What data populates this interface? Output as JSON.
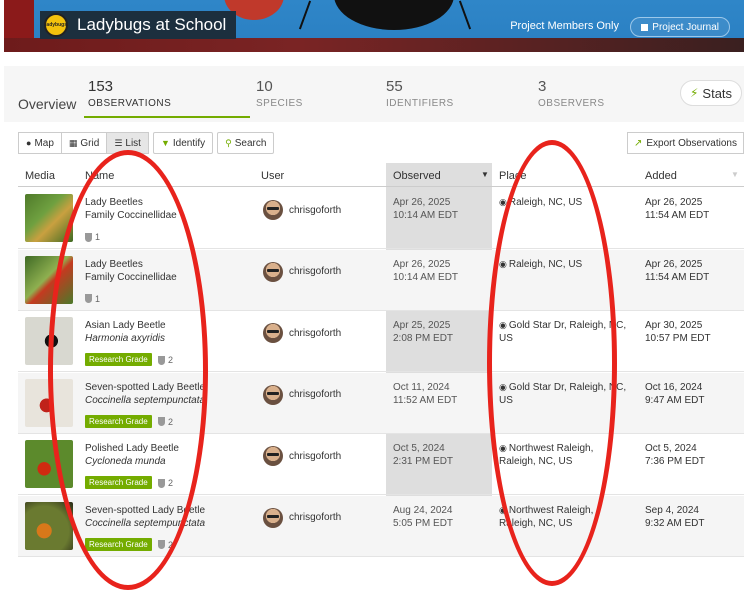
{
  "banner": {
    "logo_text": "ladybugs",
    "title": "Ladybugs at School",
    "members_label": "Project Members Only",
    "journal_label": "Project Journal"
  },
  "statsbar": {
    "overview_label": "Overview",
    "stats": [
      {
        "number": "153",
        "label": "OBSERVATIONS"
      },
      {
        "number": "10",
        "label": "SPECIES"
      },
      {
        "number": "55",
        "label": "IDENTIFIERS"
      },
      {
        "number": "3",
        "label": "OBSERVERS"
      }
    ],
    "stats_button_label": "Stats"
  },
  "toolbar": {
    "map_label": "Map",
    "grid_label": "Grid",
    "list_label": "List",
    "identify_label": "Identify",
    "search_label": "Search",
    "export_label": "Export Observations"
  },
  "table": {
    "headers": {
      "media": "Media",
      "name": "Name",
      "user": "User",
      "observed": "Observed",
      "place": "Place",
      "added": "Added"
    },
    "research_grade_label": "Research Grade",
    "rows": [
      {
        "common": "Lady Beetles",
        "sci": "Family Coccinellidae",
        "sci_italic": false,
        "grade": "",
        "ids": "1",
        "user": "chrisgoforth",
        "obs_date": "Apr 26, 2025",
        "obs_time": "10:14 AM EDT",
        "place": "Raleigh, NC, US",
        "added_date": "Apr 26, 2025",
        "added_time": "11:54 AM EDT"
      },
      {
        "common": "Lady Beetles",
        "sci": "Family Coccinellidae",
        "sci_italic": false,
        "grade": "",
        "ids": "1",
        "user": "chrisgoforth",
        "obs_date": "Apr 26, 2025",
        "obs_time": "10:14 AM EDT",
        "place": "Raleigh, NC, US",
        "added_date": "Apr 26, 2025",
        "added_time": "11:54 AM EDT"
      },
      {
        "common": "Asian Lady Beetle",
        "sci": "Harmonia axyridis",
        "sci_italic": true,
        "grade": "Research Grade",
        "ids": "2",
        "user": "chrisgoforth",
        "obs_date": "Apr 25, 2025",
        "obs_time": "2:08 PM EDT",
        "place": "Gold Star Dr, Raleigh, NC, US",
        "added_date": "Apr 30, 2025",
        "added_time": "10:57 PM EDT"
      },
      {
        "common": "Seven-spotted Lady Beetle",
        "sci": "Coccinella septempunctata",
        "sci_italic": true,
        "grade": "Research Grade",
        "ids": "2",
        "user": "chrisgoforth",
        "obs_date": "Oct 11, 2024",
        "obs_time": "11:52 AM EDT",
        "place": "Gold Star Dr, Raleigh, NC, US",
        "added_date": "Oct 16, 2024",
        "added_time": "9:47 AM EDT"
      },
      {
        "common": "Polished Lady Beetle",
        "sci": "Cycloneda munda",
        "sci_italic": true,
        "grade": "Research Grade",
        "ids": "2",
        "user": "chrisgoforth",
        "obs_date": "Oct 5, 2024",
        "obs_time": "2:31 PM EDT",
        "place": "Northwest Raleigh, Raleigh, NC, US",
        "added_date": "Oct 5, 2024",
        "added_time": "7:36 PM EDT"
      },
      {
        "common": "Seven-spotted Lady Beetle",
        "sci": "Coccinella septempunctata",
        "sci_italic": true,
        "grade": "Research Grade",
        "ids": "2",
        "user": "chrisgoforth",
        "obs_date": "Aug 24, 2024",
        "obs_time": "5:05 PM EDT",
        "place": "Northwest Raleigh, Raleigh, NC, US",
        "added_date": "Sep 4, 2024",
        "added_time": "9:32 AM EDT"
      }
    ]
  },
  "colors": {
    "accent_green": "#74ac00",
    "banner_blue": "#2a7fc2",
    "annotation_red": "#e8231c"
  }
}
